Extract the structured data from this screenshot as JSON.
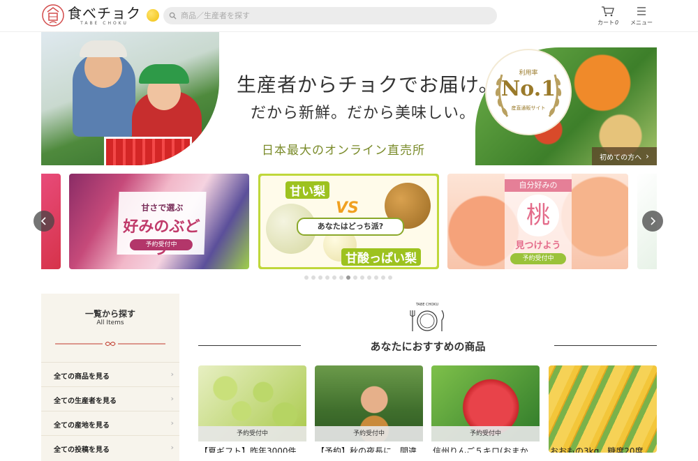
{
  "header": {
    "logo_text": "食べチョク",
    "logo_sub": "TABE CHOKU",
    "search_placeholder": "商品／生産者を探す",
    "cart_label": "カート",
    "cart_count": "0",
    "menu_label": "メニュー"
  },
  "hero": {
    "line1": "生産者からチョクでお届け。",
    "line2": "だから新鮮。だから美味しい。",
    "line3": "日本最大のオンライン直売所",
    "badge_top": "利用率",
    "badge_main": "No.1",
    "badge_bottom": "産直通販サイト",
    "first_time_button": "初めての方へ"
  },
  "carousel": {
    "grape": {
      "small": "甘さで選ぶ",
      "big": "好みのぶどう",
      "tag": "予約受付中"
    },
    "pear": {
      "top": "甘い梨",
      "vs": "VS",
      "question": "あなたはどっち派?",
      "bottom": "甘酸っぱい梨"
    },
    "peach": {
      "top": "自分好みの",
      "big": "桃",
      "mid": "見つけよう",
      "tag": "予約受付中"
    },
    "active_index": 6,
    "total": 13
  },
  "sidebar": {
    "title": "一覧から探す",
    "subtitle": "All Items",
    "items": [
      "全ての商品を見る",
      "全ての生産者を見る",
      "全ての産地を見る",
      "全ての投稿を見る"
    ]
  },
  "recommend": {
    "emblem_text": "TABE CHOKU",
    "title": "あなたにおすすめの商品",
    "products": [
      {
        "badge": "予約受付中",
        "name": "【夏ギフト】昨年3000件"
      },
      {
        "badge": "予約受付中",
        "name": "【予約】秋の夜長に…間違"
      },
      {
        "badge": "予約受付中",
        "name": "信州りんご５キロ(おまか"
      },
      {
        "badge": "",
        "name": "おおもの3kg　糖度20度"
      }
    ]
  },
  "colors": {
    "accent_green": "#9dc21f",
    "text_dark": "#333333",
    "sidebar_bg": "#f7f4ec",
    "gold": "#9a7a2a"
  }
}
